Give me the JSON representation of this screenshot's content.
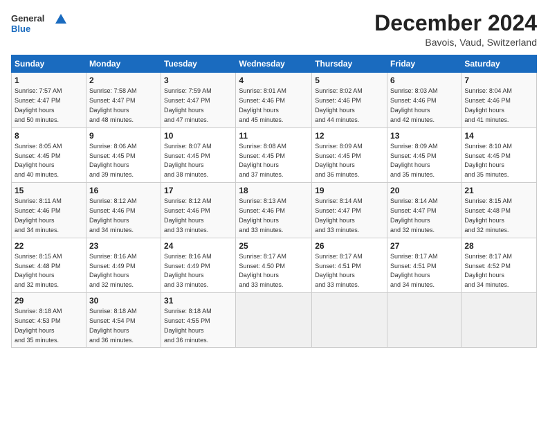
{
  "header": {
    "logo_general": "General",
    "logo_blue": "Blue",
    "title": "December 2024",
    "subtitle": "Bavois, Vaud, Switzerland"
  },
  "columns": [
    "Sunday",
    "Monday",
    "Tuesday",
    "Wednesday",
    "Thursday",
    "Friday",
    "Saturday"
  ],
  "weeks": [
    [
      {
        "day": "1",
        "rise": "7:57 AM",
        "set": "4:47 PM",
        "daylight": "8 hours and 50 minutes."
      },
      {
        "day": "2",
        "rise": "7:58 AM",
        "set": "4:47 PM",
        "daylight": "8 hours and 48 minutes."
      },
      {
        "day": "3",
        "rise": "7:59 AM",
        "set": "4:47 PM",
        "daylight": "8 hours and 47 minutes."
      },
      {
        "day": "4",
        "rise": "8:01 AM",
        "set": "4:46 PM",
        "daylight": "8 hours and 45 minutes."
      },
      {
        "day": "5",
        "rise": "8:02 AM",
        "set": "4:46 PM",
        "daylight": "8 hours and 44 minutes."
      },
      {
        "day": "6",
        "rise": "8:03 AM",
        "set": "4:46 PM",
        "daylight": "8 hours and 42 minutes."
      },
      {
        "day": "7",
        "rise": "8:04 AM",
        "set": "4:46 PM",
        "daylight": "8 hours and 41 minutes."
      }
    ],
    [
      {
        "day": "8",
        "rise": "8:05 AM",
        "set": "4:45 PM",
        "daylight": "8 hours and 40 minutes."
      },
      {
        "day": "9",
        "rise": "8:06 AM",
        "set": "4:45 PM",
        "daylight": "8 hours and 39 minutes."
      },
      {
        "day": "10",
        "rise": "8:07 AM",
        "set": "4:45 PM",
        "daylight": "8 hours and 38 minutes."
      },
      {
        "day": "11",
        "rise": "8:08 AM",
        "set": "4:45 PM",
        "daylight": "8 hours and 37 minutes."
      },
      {
        "day": "12",
        "rise": "8:09 AM",
        "set": "4:45 PM",
        "daylight": "8 hours and 36 minutes."
      },
      {
        "day": "13",
        "rise": "8:09 AM",
        "set": "4:45 PM",
        "daylight": "8 hours and 35 minutes."
      },
      {
        "day": "14",
        "rise": "8:10 AM",
        "set": "4:45 PM",
        "daylight": "8 hours and 35 minutes."
      }
    ],
    [
      {
        "day": "15",
        "rise": "8:11 AM",
        "set": "4:46 PM",
        "daylight": "8 hours and 34 minutes."
      },
      {
        "day": "16",
        "rise": "8:12 AM",
        "set": "4:46 PM",
        "daylight": "8 hours and 34 minutes."
      },
      {
        "day": "17",
        "rise": "8:12 AM",
        "set": "4:46 PM",
        "daylight": "8 hours and 33 minutes."
      },
      {
        "day": "18",
        "rise": "8:13 AM",
        "set": "4:46 PM",
        "daylight": "8 hours and 33 minutes."
      },
      {
        "day": "19",
        "rise": "8:14 AM",
        "set": "4:47 PM",
        "daylight": "8 hours and 33 minutes."
      },
      {
        "day": "20",
        "rise": "8:14 AM",
        "set": "4:47 PM",
        "daylight": "8 hours and 32 minutes."
      },
      {
        "day": "21",
        "rise": "8:15 AM",
        "set": "4:48 PM",
        "daylight": "8 hours and 32 minutes."
      }
    ],
    [
      {
        "day": "22",
        "rise": "8:15 AM",
        "set": "4:48 PM",
        "daylight": "8 hours and 32 minutes."
      },
      {
        "day": "23",
        "rise": "8:16 AM",
        "set": "4:49 PM",
        "daylight": "8 hours and 32 minutes."
      },
      {
        "day": "24",
        "rise": "8:16 AM",
        "set": "4:49 PM",
        "daylight": "8 hours and 33 minutes."
      },
      {
        "day": "25",
        "rise": "8:17 AM",
        "set": "4:50 PM",
        "daylight": "8 hours and 33 minutes."
      },
      {
        "day": "26",
        "rise": "8:17 AM",
        "set": "4:51 PM",
        "daylight": "8 hours and 33 minutes."
      },
      {
        "day": "27",
        "rise": "8:17 AM",
        "set": "4:51 PM",
        "daylight": "8 hours and 34 minutes."
      },
      {
        "day": "28",
        "rise": "8:17 AM",
        "set": "4:52 PM",
        "daylight": "8 hours and 34 minutes."
      }
    ],
    [
      {
        "day": "29",
        "rise": "8:18 AM",
        "set": "4:53 PM",
        "daylight": "8 hours and 35 minutes."
      },
      {
        "day": "30",
        "rise": "8:18 AM",
        "set": "4:54 PM",
        "daylight": "8 hours and 36 minutes."
      },
      {
        "day": "31",
        "rise": "8:18 AM",
        "set": "4:55 PM",
        "daylight": "8 hours and 36 minutes."
      },
      null,
      null,
      null,
      null
    ]
  ]
}
